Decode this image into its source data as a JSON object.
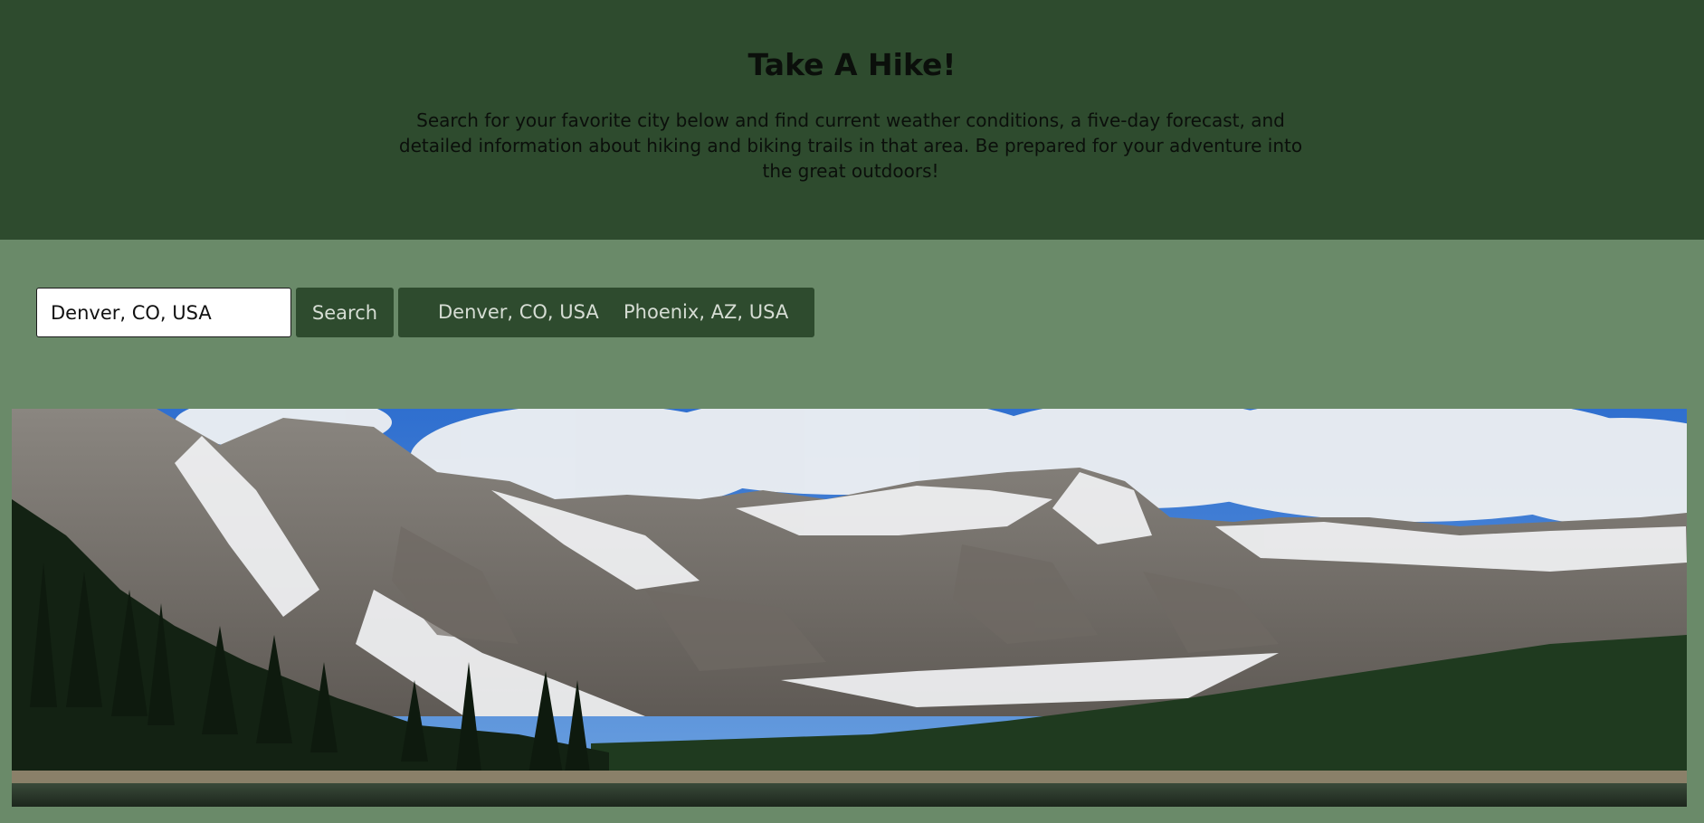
{
  "header": {
    "title": "Take A Hike!",
    "description": "Search for your favorite city below and find current weather conditions, a five-day forecast, and detailed information about hiking and biking trails in that area. Be prepared for your adventure into the great outdoors!"
  },
  "search": {
    "value": "Denver, CO, USA",
    "button_label": "Search"
  },
  "history": {
    "items": [
      {
        "label": "Denver, CO, USA"
      },
      {
        "label": "Phoenix, AZ, USA"
      }
    ]
  },
  "hero": {
    "description": "mountain lake landscape image",
    "icon": "landscape-image"
  },
  "colors": {
    "header_bg": "#2e4b2e",
    "page_bg": "#6a8a69",
    "button_bg": "#2e4b2e",
    "button_text": "#d6ddd4"
  }
}
